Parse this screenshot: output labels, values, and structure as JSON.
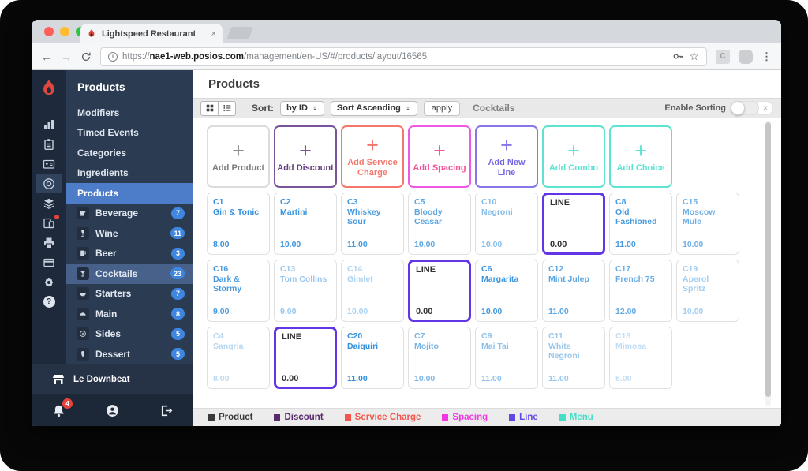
{
  "browser": {
    "tab": {
      "title": "Lightspeed Restaurant",
      "close_glyph": "×"
    },
    "nav": {
      "back": "←",
      "forward": "→"
    },
    "url": {
      "scheme": "https://",
      "domain": "nae1-web.posios.com",
      "path": "/management/en-US/#/products/layout/16565"
    },
    "extension_label": "C",
    "menu_glyph": "⋮",
    "star_glyph": "☆",
    "info_glyph": "i"
  },
  "sidebar": {
    "title": "Products",
    "items": [
      {
        "label": "Modifiers",
        "active": false
      },
      {
        "label": "Timed Events",
        "active": false
      },
      {
        "label": "Categories",
        "active": false
      },
      {
        "label": "Ingredients",
        "active": false
      },
      {
        "label": "Products",
        "active": true
      }
    ],
    "categories": [
      {
        "icon": "cup-icon",
        "label": "Beverage",
        "count": "7",
        "active": false
      },
      {
        "icon": "wine-glass-icon",
        "label": "Wine",
        "count": "11",
        "active": false
      },
      {
        "icon": "beer-mug-icon",
        "label": "Beer",
        "count": "3",
        "active": false
      },
      {
        "icon": "cocktail-glass-icon",
        "label": "Cocktails",
        "count": "23",
        "active": true
      },
      {
        "icon": "bowl-icon",
        "label": "Starters",
        "count": "7",
        "active": false
      },
      {
        "icon": "cloche-icon",
        "label": "Main",
        "count": "8",
        "active": false
      },
      {
        "icon": "circle-dot-icon",
        "label": "Sides",
        "count": "5",
        "active": false
      },
      {
        "icon": "dessert-icon",
        "label": "Dessert",
        "count": "5",
        "active": false
      }
    ],
    "location": "Le Downbeat",
    "notification_count": "4"
  },
  "main": {
    "title": "Products",
    "plus_glyph": "+",
    "line_label": "LINE",
    "toolbar": {
      "sort_label": "Sort:",
      "sort_by_value": "by ID",
      "sort_order_value": "Sort Ascending",
      "apply_label": "apply",
      "category_name": "Cocktails",
      "enable_sorting_label": "Enable Sorting",
      "close_label": "×"
    },
    "colors": {
      "product_text": "#3490dc",
      "line_border": "#6236e4"
    },
    "add_buttons": [
      {
        "label": "Add Product",
        "border": "#dcdcdc",
        "plus": "#8e8e8e",
        "text": "#7d7d7d"
      },
      {
        "label": "Add Discount",
        "border": "#7a549b",
        "plus": "#7a549b",
        "text": "#64417f"
      },
      {
        "label": "Add Service Charge",
        "border": "#f4776c",
        "plus": "#f4776c",
        "text": "#f4776c"
      },
      {
        "label": "Add Spacing",
        "border": "#ee58e4",
        "plus": "#f0549d",
        "text": "#f0549d"
      },
      {
        "label": "Add New Line",
        "border": "#8577e6",
        "plus": "#8577e6",
        "text": "#7568e2"
      },
      {
        "label": "Add Combo",
        "border": "#5ee3d3",
        "plus": "#5ee3d3",
        "text": "#5ee3d3"
      },
      {
        "label": "Add Choice",
        "border": "#5ee3d3",
        "plus": "#5ee3d3",
        "text": "#5ee3d3"
      }
    ],
    "products": [
      {
        "type": "product",
        "code": "C1",
        "name": "Gin & Tonic",
        "price": "8.00",
        "fade": 1
      },
      {
        "type": "product",
        "code": "C2",
        "name": "Martini",
        "price": "10.00",
        "fade": 0.95
      },
      {
        "type": "product",
        "code": "C3",
        "name": "Whiskey Sour",
        "price": "11.00",
        "fade": 0.9
      },
      {
        "type": "product",
        "code": "C5",
        "name": "Bloody Ceasar",
        "price": "10.00",
        "fade": 0.8
      },
      {
        "type": "product",
        "code": "C10",
        "name": "Negroni",
        "price": "10.00",
        "fade": 0.6
      },
      {
        "type": "line",
        "price": "0.00"
      },
      {
        "type": "product",
        "code": "C8",
        "name": "Old Fashioned",
        "price": "11.00",
        "fade": 0.9
      },
      {
        "type": "product",
        "code": "C15",
        "name": "Moscow Mule",
        "price": "10.00",
        "fade": 0.7
      },
      {
        "type": "product",
        "code": "C16",
        "name": "Dark & Stormy",
        "price": "9.00",
        "fade": 0.9
      },
      {
        "type": "product",
        "code": "C13",
        "name": "Tom Collins",
        "price": "9.00",
        "fade": 0.5
      },
      {
        "type": "product",
        "code": "C14",
        "name": "Gimlet",
        "price": "10.00",
        "fade": 0.4
      },
      {
        "type": "line",
        "price": "0.00"
      },
      {
        "type": "product",
        "code": "C6",
        "name": "Margarita",
        "price": "10.00",
        "fade": 0.95
      },
      {
        "type": "product",
        "code": "C12",
        "name": "Mint Julep",
        "price": "11.00",
        "fade": 0.8
      },
      {
        "type": "product",
        "code": "C17",
        "name": "French 75",
        "price": "12.00",
        "fade": 0.75
      },
      {
        "type": "product",
        "code": "C19",
        "name": "Aperol Spritz",
        "price": "10.00",
        "fade": 0.45
      },
      {
        "type": "product",
        "code": "C4",
        "name": "Sangria",
        "price": "8.00",
        "fade": 0.35
      },
      {
        "type": "line",
        "price": "0.00"
      },
      {
        "type": "product",
        "code": "C20",
        "name": "Daiquiri",
        "price": "11.00",
        "fade": 1
      },
      {
        "type": "product",
        "code": "C7",
        "name": "Mojito",
        "price": "10.00",
        "fade": 0.65
      },
      {
        "type": "product",
        "code": "C9",
        "name": "Mai Tai",
        "price": "11.00",
        "fade": 0.55
      },
      {
        "type": "product",
        "code": "C11",
        "name": "White Negroni",
        "price": "11.00",
        "fade": 0.5
      },
      {
        "type": "product",
        "code": "C18",
        "name": "Mimosa",
        "price": "8.00",
        "fade": 0.3
      }
    ],
    "legend": [
      {
        "label": "Product",
        "color": "#3a3a3a"
      },
      {
        "label": "Discount",
        "color": "#5a2a6e"
      },
      {
        "label": "Service Charge",
        "color": "#f4564c"
      },
      {
        "label": "Spacing",
        "color": "#f336e4"
      },
      {
        "label": "Line",
        "color": "#5f49e6"
      },
      {
        "label": "Menu",
        "color": "#46dfc5"
      }
    ]
  }
}
